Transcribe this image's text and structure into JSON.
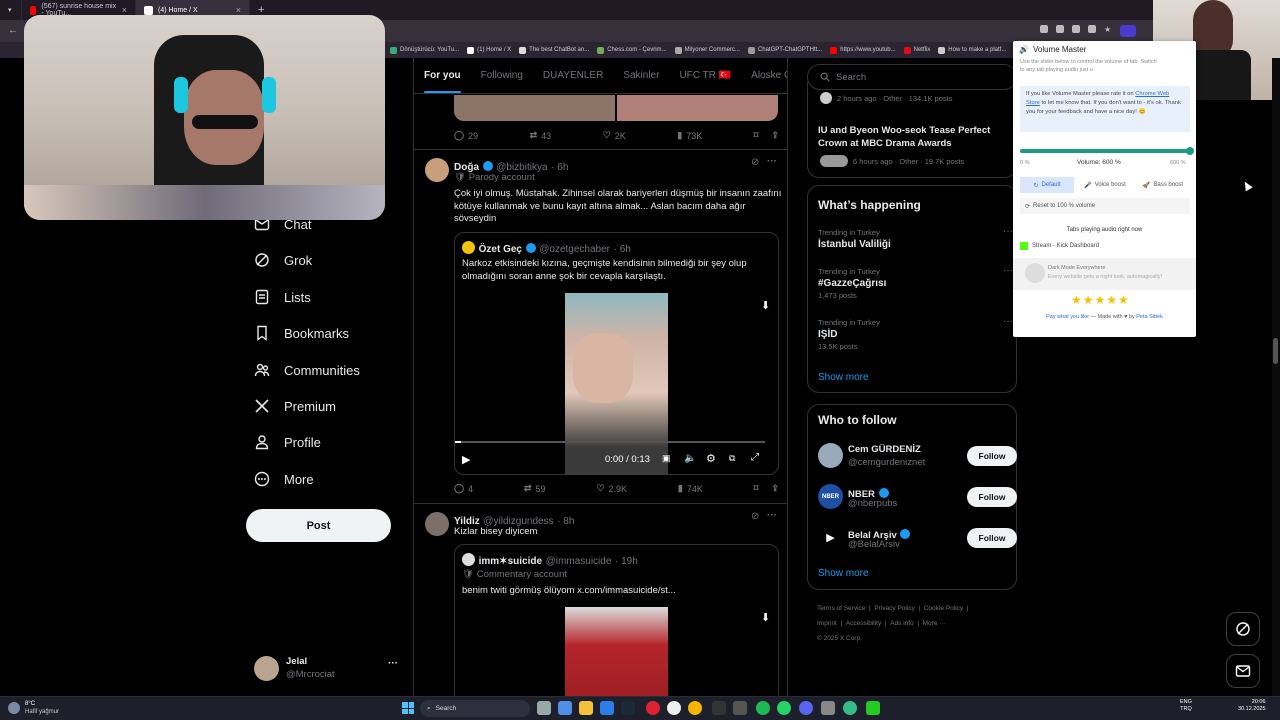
{
  "browser": {
    "tabs": [
      {
        "label": "(567) sunrise house mix - YouTu...",
        "favicon_color": "#ff0000",
        "active": false
      },
      {
        "label": "(4) Home / X",
        "favicon_color": "#ffffff",
        "active": true
      }
    ],
    "bookmarks": [
      "Dönüştürücü: YouTu...",
      "(1) Home / X",
      "The best ChatBot an...",
      "Chess.com - Çevrim...",
      "Milyoner Commerc...",
      "ChatGPT-ChatGPTHtt...",
      "https://www.youtub...",
      "Netflix",
      "How to make a platf..."
    ]
  },
  "left_nav": {
    "items": [
      {
        "label": "Chat",
        "icon": "chat-icon"
      },
      {
        "label": "Grok",
        "icon": "grok-icon"
      },
      {
        "label": "Lists",
        "icon": "lists-icon"
      },
      {
        "label": "Bookmarks",
        "icon": "bookmark-icon"
      },
      {
        "label": "Communities",
        "icon": "communities-icon"
      },
      {
        "label": "Premium",
        "icon": "x-logo-icon"
      },
      {
        "label": "Profile",
        "icon": "profile-icon"
      },
      {
        "label": "More",
        "icon": "more-circle-icon"
      }
    ],
    "post_label": "Post",
    "user": {
      "name": "Jelal",
      "handle": "@Mrcrociat",
      "menu": "···"
    }
  },
  "feed": {
    "tabs": [
      {
        "label": "For you",
        "active": true
      },
      {
        "label": "Following"
      },
      {
        "label": "DUAYENLER"
      },
      {
        "label": "Sakinler"
      },
      {
        "label": "UFC TR 🇹🇷"
      },
      {
        "label": "Aloske Gang"
      }
    ],
    "top_actions": {
      "replies": "29",
      "reposts": "43",
      "likes": "2K",
      "views": "73K"
    },
    "posts": [
      {
        "name": "Doğa",
        "handle": "@bizbitikya",
        "time": "· 6h",
        "badge": "Parody account",
        "text": "Çok iyi olmuş. Müstahak. Zihinsel olarak bariyerleri düşmüş bir insanın zaafını kötüye kullanmak ve bunu kayıt altına almak... Aslan bacım daha ağır sövseydin",
        "quote": {
          "name": "Özet Geç",
          "handle": "@ozetgechaber",
          "time": "· 6h",
          "text": "Narkoz etkisindeki kızına, geçmişte kendisinin bilmediği bir şey olup olmadığını soran anne şok bir cevapla karşılaştı.",
          "video_time": "0:00 / 0:13",
          "video_progress": 0.02
        },
        "actions": {
          "replies": "4",
          "reposts": "59",
          "likes": "2.9K",
          "views": "74K"
        }
      },
      {
        "name": "Yildiz",
        "handle": "@yildizgundess",
        "time": "· 8h",
        "text": "Kizlar bisey diyicem",
        "quote": {
          "name": "imm✶suicide",
          "handle": "@immasuicide",
          "time": "· 19h",
          "badge": "Commentary account",
          "text": "benim twiti görmüş ölüyom  x.com/immasuicide/st..."
        }
      }
    ]
  },
  "right": {
    "search_placeholder": "Search",
    "top_trends": [
      {
        "meta": "2 hours ago · Other · 134.1K posts"
      },
      {
        "title": "IU and Byeon Woo-seok Tease Perfect Crown at MBC Drama Awards",
        "meta": "6 hours ago · Other · 19.7K posts"
      }
    ],
    "happening": {
      "title": "What’s happening",
      "trends": [
        {
          "context": "Trending in Turkey",
          "name": "İstanbul Valiliği",
          "posts": ""
        },
        {
          "context": "Trending in Turkey",
          "name": "#GazzeÇağrısı",
          "posts": "1,473 posts"
        },
        {
          "context": "Trending in Turkey",
          "name": "IŞİD",
          "posts": "13.5K posts"
        }
      ],
      "show_more": "Show more"
    },
    "who_to_follow": {
      "title": "Who to follow",
      "accounts": [
        {
          "name": "Cem GÜRDENİZ",
          "handle": "@cemgurdeniznet",
          "verified": false,
          "button": "Follow"
        },
        {
          "name": "NBER",
          "handle": "@nberpubs",
          "verified": true,
          "button": "Follow"
        },
        {
          "name": "Belal Arşiv",
          "handle": "@BelalArsiv",
          "verified": true,
          "button": "Follow"
        }
      ],
      "show_more": "Show more"
    },
    "footer": {
      "links": [
        "Terms of Service",
        "|",
        "Privacy Policy",
        "|",
        "Cookie Policy",
        "|",
        "Imprint",
        "|",
        "Accessibility",
        "|",
        "Ads info",
        "|",
        "More ···"
      ],
      "copyright": "© 2025 X Corp."
    }
  },
  "volume_master": {
    "title": "Volume Master",
    "intro": "Use the slider below to control the volume of tab. Switch to any tab playing audio just u",
    "note_pre": "If you like Volume Master please rate it on ",
    "note_link": "Chrome Web Store",
    "note_post": " to let me know that. If you don't want to - it's ok. Thank you for your feedback and have a nice day! 😊",
    "min_label": "0 %",
    "volume_label": "Volume: 600 %",
    "max_label": "600 %",
    "level": 1.0,
    "buttons": [
      "Default",
      "Voice boost",
      "Bass boost"
    ],
    "reset_label": "Reset to 100 % volume",
    "tabs_title": "Tabs playing audio right now",
    "tab_item": "Stream - Kick Dashboard",
    "dark_title": "Dark Mode Everywhere",
    "dark_sub": "Every website gets a night look, automagically!",
    "rating": 5,
    "footer_pre": "Pay what you like",
    "footer_mid": " — Made with ♥ by ",
    "footer_author": "Peta Sittek"
  },
  "taskbar": {
    "weather_temp": "8°C",
    "weather_desc": "Hafif yağmur",
    "search_label": "Search",
    "lang_top": "ENG",
    "lang_bottom": "TRQ",
    "time": "20:06",
    "date": "30.12.2025"
  },
  "colors": {
    "accent": "#1d9bf0",
    "bg": "#000000",
    "border": "#2f3336",
    "muted": "#71767b",
    "vm_teal": "#1b9c82"
  }
}
